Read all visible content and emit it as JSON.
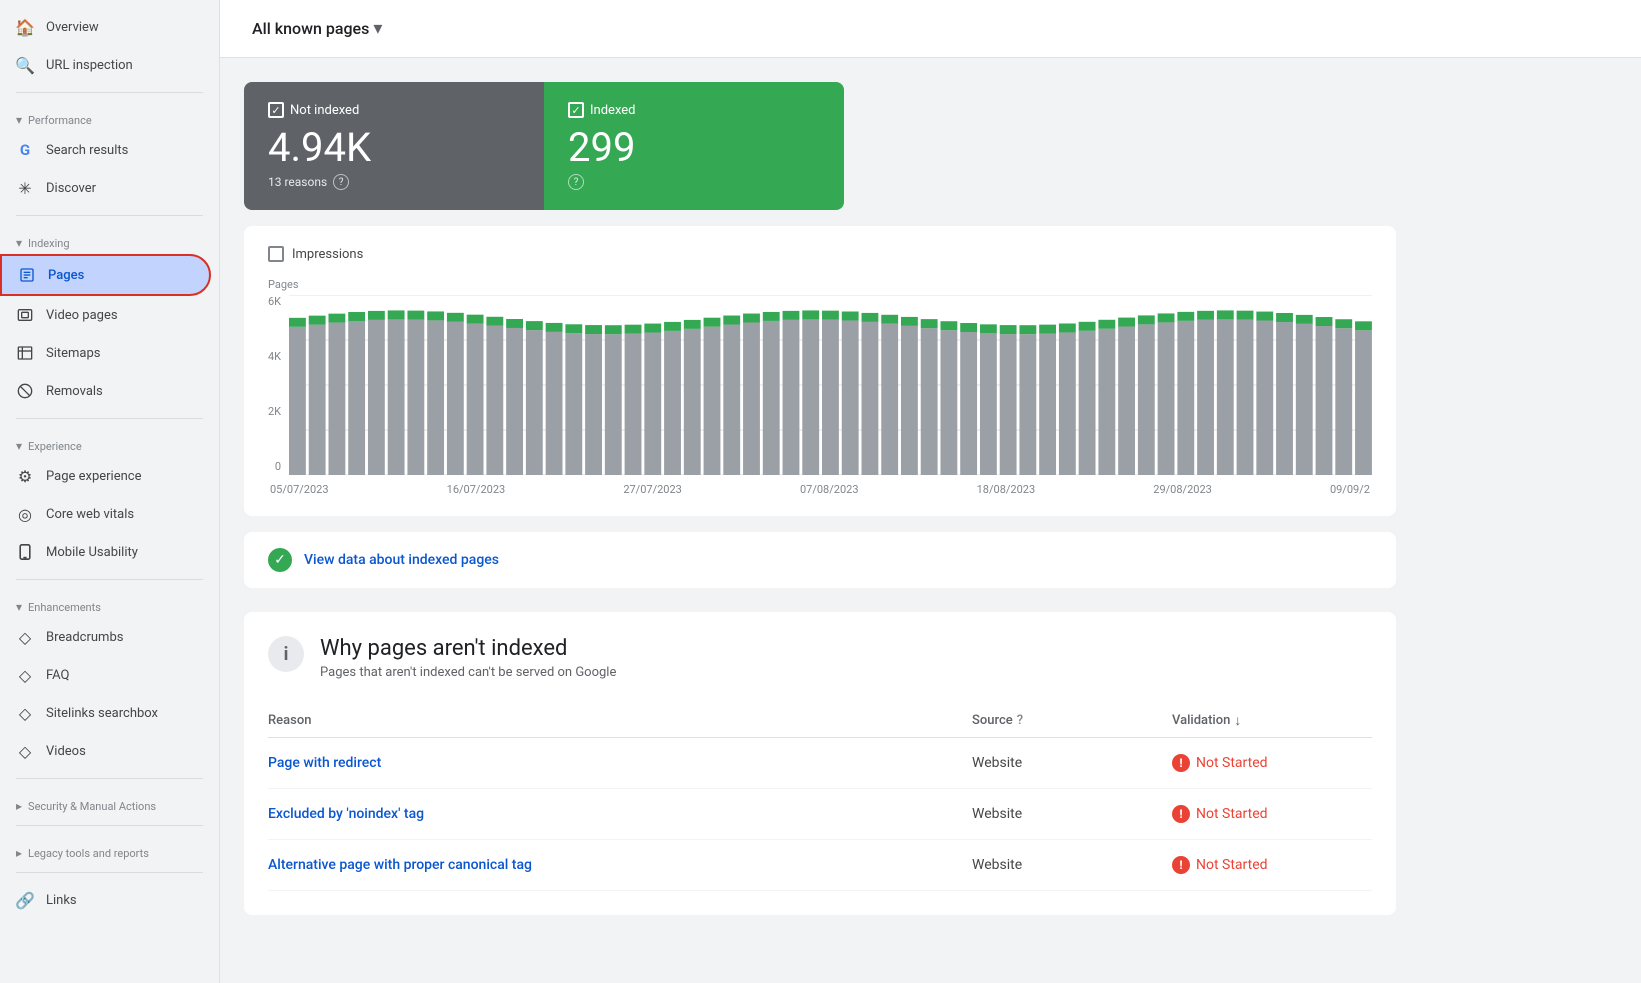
{
  "sidebar": {
    "items": [
      {
        "id": "overview",
        "label": "Overview",
        "icon": "🏠",
        "active": false
      },
      {
        "id": "url-inspection",
        "label": "URL inspection",
        "icon": "🔍",
        "active": false
      }
    ],
    "sections": [
      {
        "id": "performance",
        "label": "Performance",
        "items": [
          {
            "id": "search-results",
            "label": "Search results",
            "icon": "G",
            "active": false
          },
          {
            "id": "discover",
            "label": "Discover",
            "icon": "✳",
            "active": false
          }
        ]
      },
      {
        "id": "indexing",
        "label": "Indexing",
        "items": [
          {
            "id": "pages",
            "label": "Pages",
            "icon": "📄",
            "active": true
          },
          {
            "id": "video-pages",
            "label": "Video pages",
            "icon": "🎬",
            "active": false
          },
          {
            "id": "sitemaps",
            "label": "Sitemaps",
            "icon": "🗺",
            "active": false
          },
          {
            "id": "removals",
            "label": "Removals",
            "icon": "🚫",
            "active": false
          }
        ]
      },
      {
        "id": "experience",
        "label": "Experience",
        "items": [
          {
            "id": "page-experience",
            "label": "Page experience",
            "icon": "⚙",
            "active": false
          },
          {
            "id": "core-web-vitals",
            "label": "Core web vitals",
            "icon": "◎",
            "active": false
          },
          {
            "id": "mobile-usability",
            "label": "Mobile Usability",
            "icon": "📱",
            "active": false
          }
        ]
      },
      {
        "id": "enhancements",
        "label": "Enhancements",
        "items": [
          {
            "id": "breadcrumbs",
            "label": "Breadcrumbs",
            "icon": "◇",
            "active": false
          },
          {
            "id": "faq",
            "label": "FAQ",
            "icon": "◇",
            "active": false
          },
          {
            "id": "sitelinks-searchbox",
            "label": "Sitelinks searchbox",
            "icon": "◇",
            "active": false
          },
          {
            "id": "videos",
            "label": "Videos",
            "icon": "◇",
            "active": false
          }
        ]
      },
      {
        "id": "security",
        "label": "Security & Manual Actions",
        "items": []
      },
      {
        "id": "legacy",
        "label": "Legacy tools and reports",
        "items": []
      }
    ],
    "bottom_items": [
      {
        "id": "links",
        "label": "Links",
        "icon": "🔗"
      }
    ]
  },
  "header": {
    "page_selector_label": "All known pages",
    "dropdown_aria": "Change page filter"
  },
  "stats": {
    "not_indexed": {
      "label": "Not indexed",
      "value": "4.94K",
      "sub": "13 reasons"
    },
    "indexed": {
      "label": "Indexed",
      "value": "299"
    }
  },
  "chart": {
    "impressions_label": "Impressions",
    "y_label": "Pages",
    "y_values": [
      "6K",
      "4K",
      "2K",
      "0"
    ],
    "x_labels": [
      "05/07/2023",
      "16/07/2023",
      "27/07/2023",
      "07/08/2023",
      "18/08/2023",
      "29/08/2023",
      "09/09/2"
    ]
  },
  "view_data": {
    "label": "View data about indexed pages"
  },
  "why_section": {
    "title": "Why pages aren't indexed",
    "subtitle": "Pages that aren't indexed can't be served on Google",
    "table": {
      "headers": [
        {
          "id": "reason",
          "label": "Reason"
        },
        {
          "id": "source",
          "label": "Source"
        },
        {
          "id": "validation",
          "label": "Validation",
          "sortable": true
        }
      ],
      "rows": [
        {
          "reason": "Page with redirect",
          "source": "Website",
          "validation": "Not Started"
        },
        {
          "reason": "Excluded by 'noindex' tag",
          "source": "Website",
          "validation": "Not Started"
        },
        {
          "reason": "Alternative page with proper canonical tag",
          "source": "Website",
          "validation": "Not Started"
        }
      ]
    }
  }
}
